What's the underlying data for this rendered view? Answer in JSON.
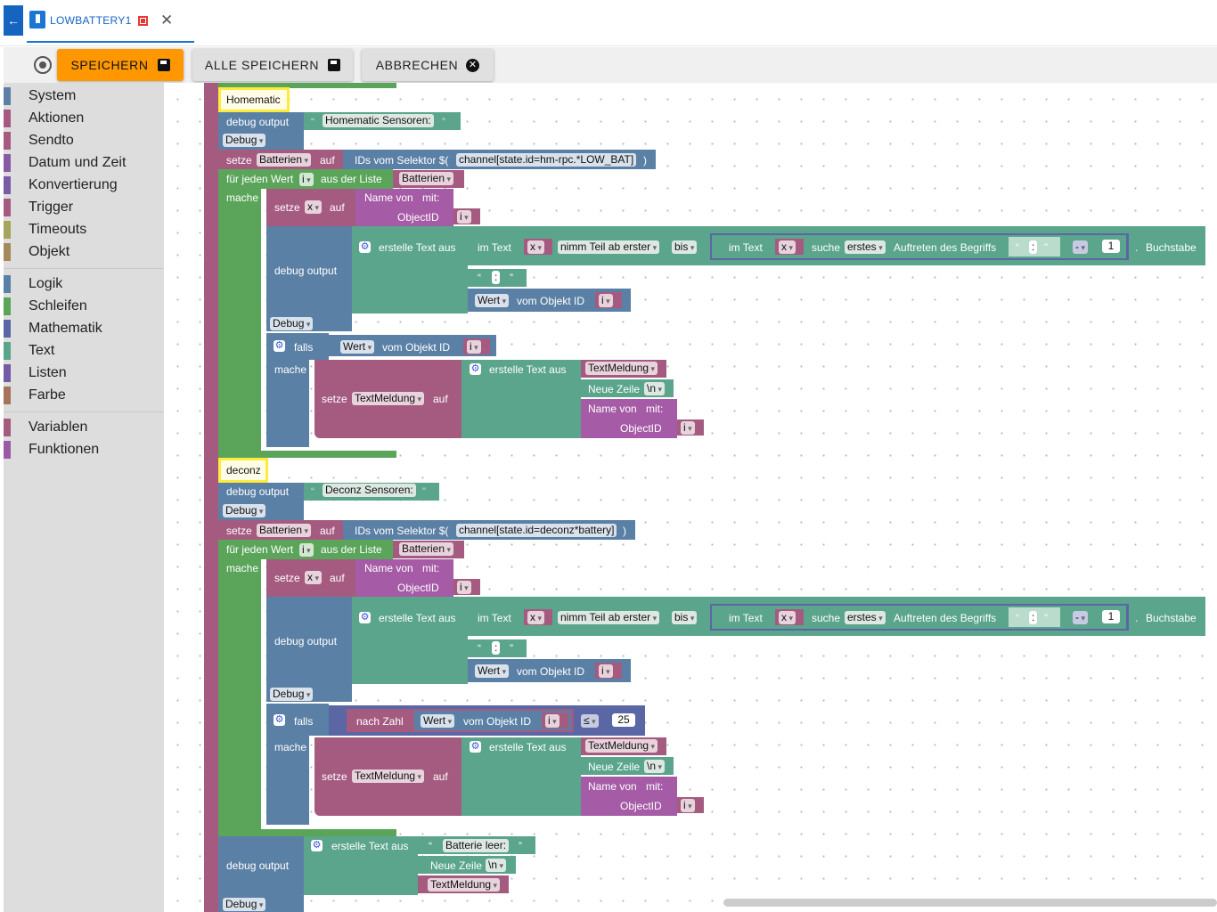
{
  "tab": {
    "title": "LOWBATTERY1"
  },
  "toolbar": {
    "save": "SPEICHERN",
    "save_all": "ALLE SPEICHERN",
    "cancel": "ABBRECHEN"
  },
  "colors": {
    "accent": "#ff9800",
    "tab": "#1976d2",
    "sys": "#5b80a5",
    "var": "#a55b80",
    "loop": "#5ba55b",
    "text": "#5ba58c",
    "list": "#745ba5",
    "obj": "#a5745b"
  },
  "categories": [
    {
      "label": "System",
      "color": "#5b80a5"
    },
    {
      "label": "Aktionen",
      "color": "#a55b80"
    },
    {
      "label": "Sendto",
      "color": "#a55b80"
    },
    {
      "label": "Datum und Zeit",
      "color": "#a55ba5"
    },
    {
      "label": "Konvertierung",
      "color": "#a55b80"
    },
    {
      "label": "Trigger",
      "color": "#a55b80"
    },
    {
      "label": "Timeouts",
      "color": "#a5a55b"
    },
    {
      "label": "Objekt",
      "color": "#a5885b"
    },
    {
      "label": "Logik",
      "color": "#5b80a5"
    },
    {
      "label": "Schleifen",
      "color": "#5ba55b"
    },
    {
      "label": "Mathematik",
      "color": "#5b67a5"
    },
    {
      "label": "Text",
      "color": "#5ba58c"
    },
    {
      "label": "Listen",
      "color": "#745ba5"
    },
    {
      "label": "Farbe",
      "color": "#a5745b"
    },
    {
      "label": "Variablen",
      "color": "#a55b80"
    },
    {
      "label": "Funktionen",
      "color": "#9a5ba5"
    }
  ],
  "blocks": {
    "comment1": "Homematic",
    "comment2": "deconz",
    "debug_output": "debug output",
    "debug": "Debug",
    "hm_text": "Homematic Sensoren:",
    "dc_text": "Deconz Sensoren:",
    "setze": "setze",
    "auf": "auf",
    "batterien": "Batterien",
    "ids": "IDs vom Selektor $(",
    "hm_sel": "channel[state.id=hm-rpc.*LOW_BAT]",
    "dc_sel": "channel[state.id=deconz*battery]",
    "close": ")",
    "fuer": "für jeden Wert",
    "i": "i",
    "aus": "aus der Liste",
    "mache": "mache",
    "x": "x",
    "name_von": "Name von",
    "mit": "mit:",
    "objectid": "ObjectID",
    "erstelle": "erstelle Text aus",
    "im_text": "im Text",
    "nimm": "nimm Teil ab erster",
    "bis": "bis",
    "suche": "suche",
    "erstes": "erstes",
    "auftreten": "Auftreten des Begriffs",
    "colon": ":",
    "minus": "-",
    "one": "1",
    "buchstabe": "Buchstabe",
    "dot": ".",
    "wert": "Wert",
    "vom_objekt": "vom Objekt ID",
    "falls": "falls",
    "textmeldung": "TextMeldung",
    "neue_zeile": "Neue Zeile",
    "nl": "\\n",
    "nach_zahl": "nach Zahl",
    "le": "≤",
    "n25": "25",
    "batterie_leer": "Batterie leer:",
    "lq": "“",
    "rq": "”"
  }
}
